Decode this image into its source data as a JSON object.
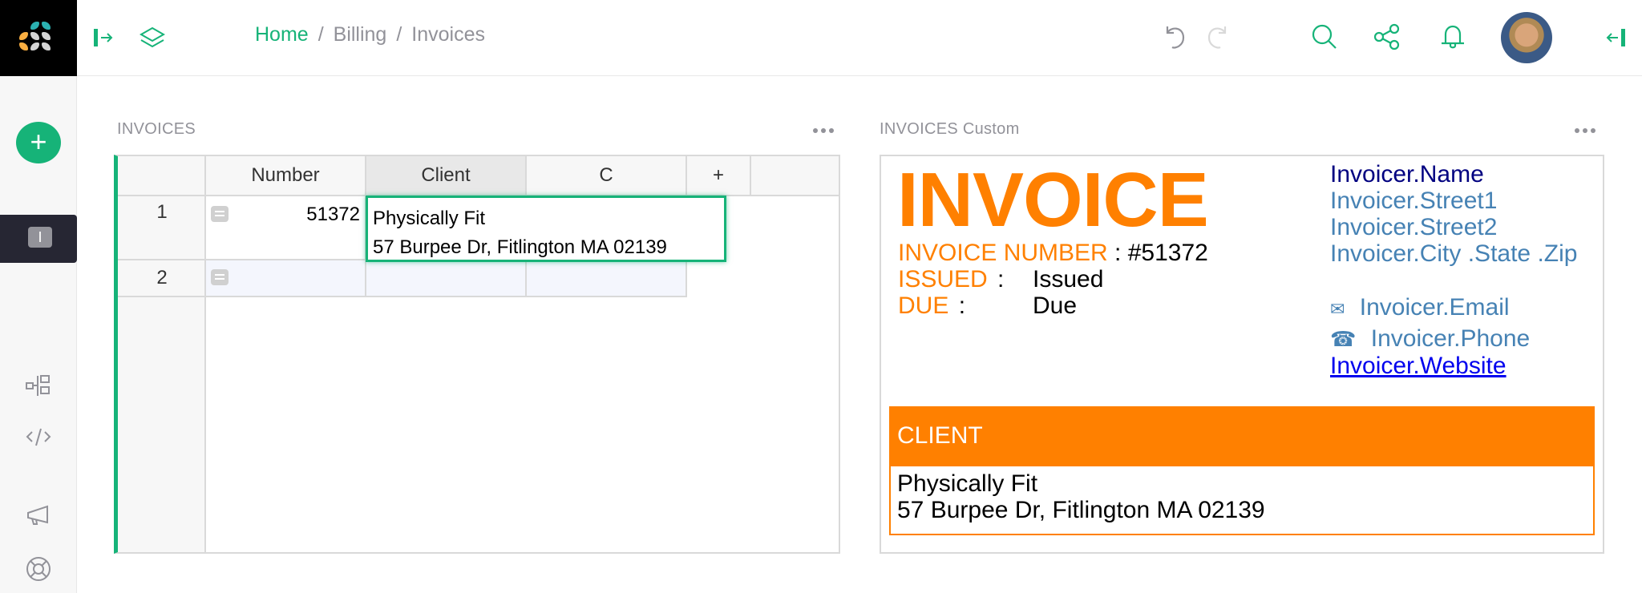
{
  "app": {
    "brand_colors": {
      "accent": "#16b378",
      "dark": "#262633",
      "muted": "#929299"
    }
  },
  "topbar": {
    "breadcrumb": [
      {
        "label": "Home"
      },
      {
        "label": "Billing"
      },
      {
        "label": "Invoices"
      }
    ],
    "separator": "/",
    "icons": [
      "panel-expand-icon",
      "layers-icon",
      "undo-icon",
      "redo-icon",
      "search-icon",
      "share-icon",
      "bell-icon",
      "avatar",
      "panel-collapse-icon"
    ]
  },
  "rail": {
    "add_label": "+",
    "page_initial": "I",
    "icons": [
      "raw-data-icon",
      "code-icon",
      "megaphone-icon",
      "help-icon"
    ]
  },
  "grid_section": {
    "title": "INVOICES",
    "columns": [
      "Number",
      "Client",
      "C",
      "+"
    ],
    "rows": [
      {
        "num": "1",
        "Number": "51372",
        "Client": "Physically Fit\n57 Burpee Dr, Fitlington MA 02139",
        "C": ""
      },
      {
        "num": "2",
        "Number": "",
        "Client": "",
        "C": ""
      }
    ],
    "editor": {
      "line1": "Physically Fit",
      "line2": "57 Burpee Dr, Fitlington MA 02139"
    }
  },
  "custom_section": {
    "title": "INVOICES Custom",
    "invoice": {
      "heading": "INVOICE",
      "number_label": "INVOICE NUMBER",
      "number_value": ": #51372",
      "issued_label": "ISSUED",
      "issued_sep": ":",
      "issued_value": "Issued",
      "due_label": "DUE",
      "due_sep": ":",
      "due_value": "Due",
      "colors": {
        "orange": "#ff8000",
        "navy": "#000080",
        "steel": "#4682b4",
        "link": "#0000ee"
      }
    },
    "invoicer": {
      "name": "Invoicer.Name",
      "street1": "Invoicer.Street1",
      "street2": "Invoicer.Street2",
      "city_state_zip": "Invoicer.City .State .Zip",
      "email_icon": "✉",
      "email": "Invoicer.Email",
      "phone_icon": "☎",
      "phone": "Invoicer.Phone",
      "website": "Invoicer.Website"
    },
    "client": {
      "heading": "CLIENT",
      "name": "Physically Fit",
      "address": "57 Burpee Dr, Fitlington MA 02139"
    }
  }
}
